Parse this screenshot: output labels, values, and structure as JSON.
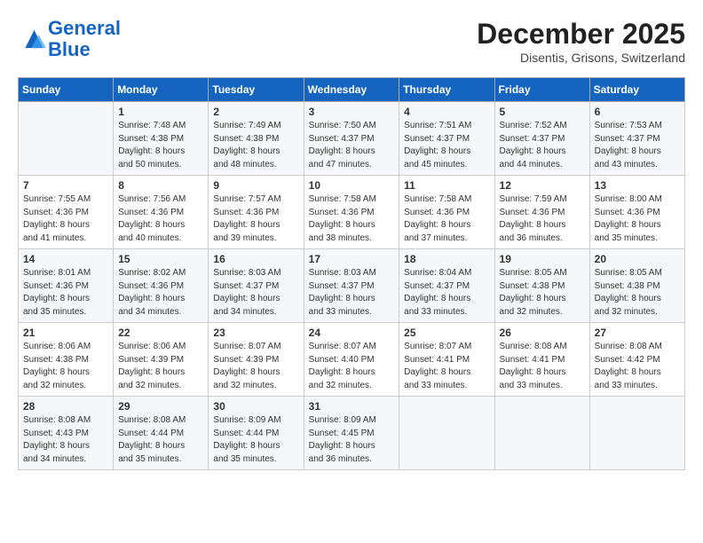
{
  "header": {
    "logo_general": "General",
    "logo_blue": "Blue",
    "month": "December 2025",
    "location": "Disentis, Grisons, Switzerland"
  },
  "weekdays": [
    "Sunday",
    "Monday",
    "Tuesday",
    "Wednesday",
    "Thursday",
    "Friday",
    "Saturday"
  ],
  "weeks": [
    [
      {
        "day": "",
        "info": ""
      },
      {
        "day": "1",
        "info": "Sunrise: 7:48 AM\nSunset: 4:38 PM\nDaylight: 8 hours\nand 50 minutes."
      },
      {
        "day": "2",
        "info": "Sunrise: 7:49 AM\nSunset: 4:38 PM\nDaylight: 8 hours\nand 48 minutes."
      },
      {
        "day": "3",
        "info": "Sunrise: 7:50 AM\nSunset: 4:37 PM\nDaylight: 8 hours\nand 47 minutes."
      },
      {
        "day": "4",
        "info": "Sunrise: 7:51 AM\nSunset: 4:37 PM\nDaylight: 8 hours\nand 45 minutes."
      },
      {
        "day": "5",
        "info": "Sunrise: 7:52 AM\nSunset: 4:37 PM\nDaylight: 8 hours\nand 44 minutes."
      },
      {
        "day": "6",
        "info": "Sunrise: 7:53 AM\nSunset: 4:37 PM\nDaylight: 8 hours\nand 43 minutes."
      }
    ],
    [
      {
        "day": "7",
        "info": "Sunrise: 7:55 AM\nSunset: 4:36 PM\nDaylight: 8 hours\nand 41 minutes."
      },
      {
        "day": "8",
        "info": "Sunrise: 7:56 AM\nSunset: 4:36 PM\nDaylight: 8 hours\nand 40 minutes."
      },
      {
        "day": "9",
        "info": "Sunrise: 7:57 AM\nSunset: 4:36 PM\nDaylight: 8 hours\nand 39 minutes."
      },
      {
        "day": "10",
        "info": "Sunrise: 7:58 AM\nSunset: 4:36 PM\nDaylight: 8 hours\nand 38 minutes."
      },
      {
        "day": "11",
        "info": "Sunrise: 7:58 AM\nSunset: 4:36 PM\nDaylight: 8 hours\nand 37 minutes."
      },
      {
        "day": "12",
        "info": "Sunrise: 7:59 AM\nSunset: 4:36 PM\nDaylight: 8 hours\nand 36 minutes."
      },
      {
        "day": "13",
        "info": "Sunrise: 8:00 AM\nSunset: 4:36 PM\nDaylight: 8 hours\nand 35 minutes."
      }
    ],
    [
      {
        "day": "14",
        "info": "Sunrise: 8:01 AM\nSunset: 4:36 PM\nDaylight: 8 hours\nand 35 minutes."
      },
      {
        "day": "15",
        "info": "Sunrise: 8:02 AM\nSunset: 4:36 PM\nDaylight: 8 hours\nand 34 minutes."
      },
      {
        "day": "16",
        "info": "Sunrise: 8:03 AM\nSunset: 4:37 PM\nDaylight: 8 hours\nand 34 minutes."
      },
      {
        "day": "17",
        "info": "Sunrise: 8:03 AM\nSunset: 4:37 PM\nDaylight: 8 hours\nand 33 minutes."
      },
      {
        "day": "18",
        "info": "Sunrise: 8:04 AM\nSunset: 4:37 PM\nDaylight: 8 hours\nand 33 minutes."
      },
      {
        "day": "19",
        "info": "Sunrise: 8:05 AM\nSunset: 4:38 PM\nDaylight: 8 hours\nand 32 minutes."
      },
      {
        "day": "20",
        "info": "Sunrise: 8:05 AM\nSunset: 4:38 PM\nDaylight: 8 hours\nand 32 minutes."
      }
    ],
    [
      {
        "day": "21",
        "info": "Sunrise: 8:06 AM\nSunset: 4:38 PM\nDaylight: 8 hours\nand 32 minutes."
      },
      {
        "day": "22",
        "info": "Sunrise: 8:06 AM\nSunset: 4:39 PM\nDaylight: 8 hours\nand 32 minutes."
      },
      {
        "day": "23",
        "info": "Sunrise: 8:07 AM\nSunset: 4:39 PM\nDaylight: 8 hours\nand 32 minutes."
      },
      {
        "day": "24",
        "info": "Sunrise: 8:07 AM\nSunset: 4:40 PM\nDaylight: 8 hours\nand 32 minutes."
      },
      {
        "day": "25",
        "info": "Sunrise: 8:07 AM\nSunset: 4:41 PM\nDaylight: 8 hours\nand 33 minutes."
      },
      {
        "day": "26",
        "info": "Sunrise: 8:08 AM\nSunset: 4:41 PM\nDaylight: 8 hours\nand 33 minutes."
      },
      {
        "day": "27",
        "info": "Sunrise: 8:08 AM\nSunset: 4:42 PM\nDaylight: 8 hours\nand 33 minutes."
      }
    ],
    [
      {
        "day": "28",
        "info": "Sunrise: 8:08 AM\nSunset: 4:43 PM\nDaylight: 8 hours\nand 34 minutes."
      },
      {
        "day": "29",
        "info": "Sunrise: 8:08 AM\nSunset: 4:44 PM\nDaylight: 8 hours\nand 35 minutes."
      },
      {
        "day": "30",
        "info": "Sunrise: 8:09 AM\nSunset: 4:44 PM\nDaylight: 8 hours\nand 35 minutes."
      },
      {
        "day": "31",
        "info": "Sunrise: 8:09 AM\nSunset: 4:45 PM\nDaylight: 8 hours\nand 36 minutes."
      },
      {
        "day": "",
        "info": ""
      },
      {
        "day": "",
        "info": ""
      },
      {
        "day": "",
        "info": ""
      }
    ]
  ]
}
